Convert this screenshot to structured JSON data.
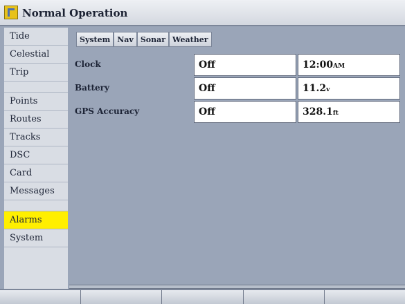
{
  "window": {
    "title": "Normal Operation",
    "icon": "garmin-flag-icon"
  },
  "sidebar": {
    "items": [
      {
        "label": "Tide",
        "kind": "item"
      },
      {
        "label": "Celestial",
        "kind": "item"
      },
      {
        "label": "Trip",
        "kind": "item"
      },
      {
        "label": "",
        "kind": "divider"
      },
      {
        "label": "Points",
        "kind": "item"
      },
      {
        "label": "Routes",
        "kind": "item"
      },
      {
        "label": "Tracks",
        "kind": "item"
      },
      {
        "label": "DSC",
        "kind": "item"
      },
      {
        "label": "Card",
        "kind": "item"
      },
      {
        "label": "Messages",
        "kind": "item"
      },
      {
        "label": "",
        "kind": "divider"
      },
      {
        "label": "Alarms",
        "kind": "active"
      },
      {
        "label": "System",
        "kind": "item"
      }
    ]
  },
  "tabs": [
    "System",
    "Nav",
    "Sonar",
    "Weather"
  ],
  "alarms": [
    {
      "label": "Clock",
      "state": "Off",
      "value": "12:00",
      "unit": "AM"
    },
    {
      "label": "Battery",
      "state": "Off",
      "value": "11.2",
      "unit": "v"
    },
    {
      "label": "GPS Accuracy",
      "state": "Off",
      "value": "328.1",
      "unit": "ft"
    }
  ],
  "colors": {
    "active_highlight": "#ffef00",
    "panel": "#9aa5b8"
  }
}
